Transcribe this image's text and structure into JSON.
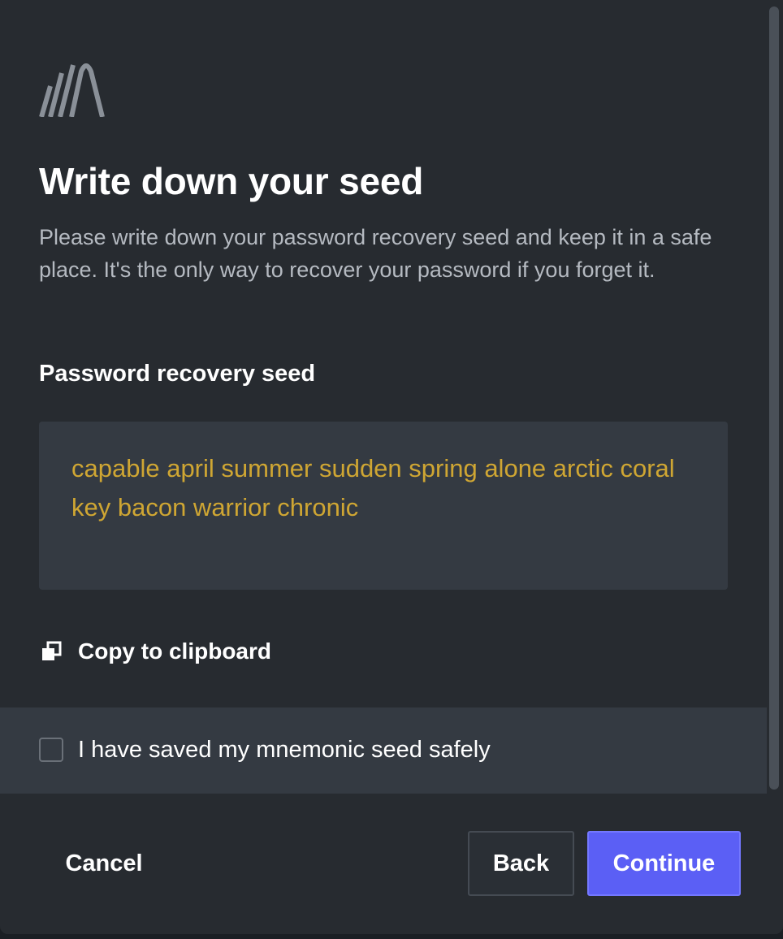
{
  "dialog": {
    "logo_icon": "app-logo-icon",
    "title": "Write down your seed",
    "description": "Please write down your password recovery seed and keep it in a safe place. It's the only way to recover your password if you forget it.",
    "seed_label": "Password recovery seed",
    "seed_phrase": "capable april summer sudden spring alone arctic coral key bacon warrior chronic",
    "copy_icon": "copy-icon",
    "copy_label": "Copy to clipboard",
    "confirm_label": "I have saved my mnemonic seed safely",
    "confirm_checked": false
  },
  "footer": {
    "cancel_label": "Cancel",
    "back_label": "Back",
    "continue_label": "Continue"
  },
  "colors": {
    "background": "#272b30",
    "panel": "#343a42",
    "seed_text": "#cfa633",
    "primary": "#5b5ff5",
    "muted_text": "#b5bac1"
  }
}
